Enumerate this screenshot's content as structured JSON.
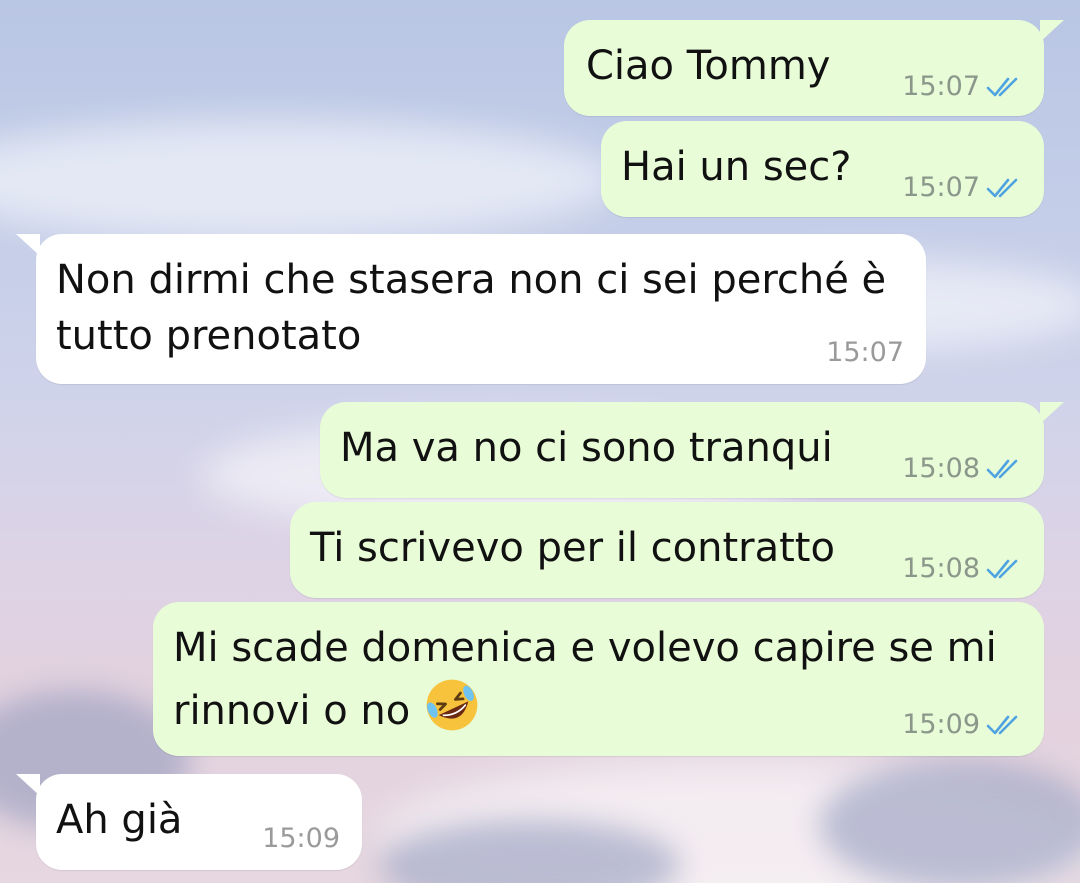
{
  "colors": {
    "outgoing_bubble": "#e8fcd8",
    "incoming_bubble": "#ffffff",
    "read_ticks": "#4fa3e0"
  },
  "messages": [
    {
      "direction": "outgoing",
      "text": "Ciao Tommy",
      "time": "15:07",
      "status": "read",
      "status_icon": "double-check-icon"
    },
    {
      "direction": "outgoing",
      "text": "Hai un sec?",
      "time": "15:07",
      "status": "read",
      "status_icon": "double-check-icon"
    },
    {
      "direction": "incoming",
      "text": "Non dirmi che stasera non ci sei perché è\ntutto prenotato",
      "time": "15:07"
    },
    {
      "direction": "outgoing",
      "text": "Ma va no ci sono tranqui",
      "time": "15:08",
      "status": "read",
      "status_icon": "double-check-icon"
    },
    {
      "direction": "outgoing",
      "text": "Ti scrivevo per il contratto",
      "time": "15:08",
      "status": "read",
      "status_icon": "double-check-icon"
    },
    {
      "direction": "outgoing",
      "text": "Mi scade domenica e volevo capire se mi\nrinnovi o no ",
      "emoji": "rolling-on-floor-laughing-emoji",
      "time": "15:09",
      "status": "read",
      "status_icon": "double-check-icon"
    },
    {
      "direction": "incoming",
      "text": "Ah già",
      "time": "15:09"
    }
  ]
}
